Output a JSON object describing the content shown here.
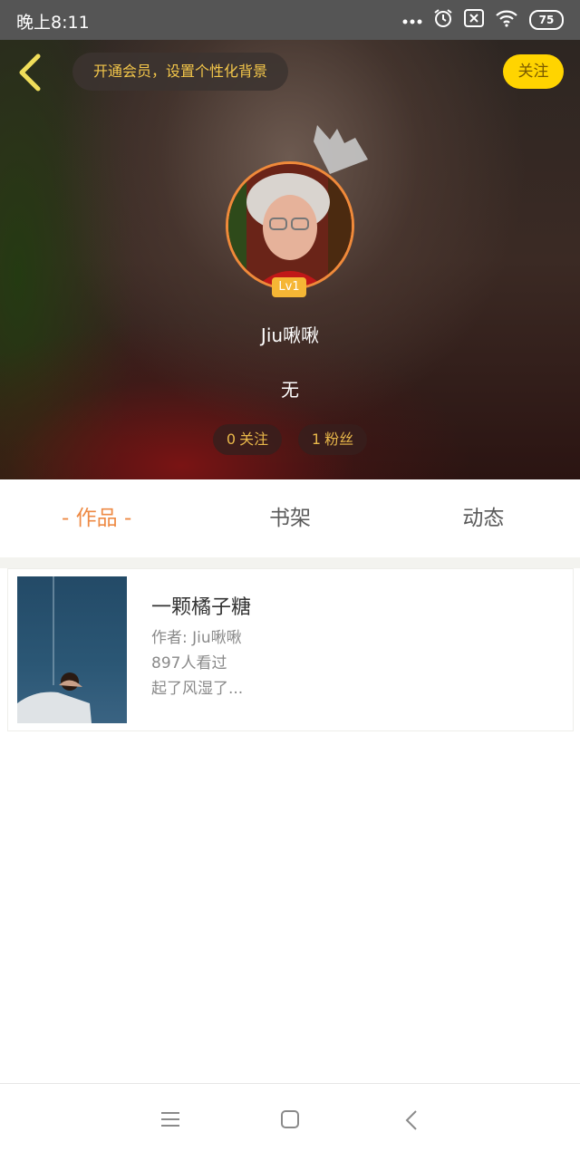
{
  "status_bar": {
    "time": "晚上8:11",
    "battery": "75",
    "icons": [
      "more-dots-icon",
      "alarm-icon",
      "sim-off-icon",
      "wifi-icon",
      "battery-icon"
    ]
  },
  "header": {
    "vip_banner": "开通会员，设置个性化背景",
    "follow_label": "关注",
    "accent_color": "#ffd400"
  },
  "profile": {
    "level": "Lv1",
    "username": "Jiu啾啾",
    "bio": "无",
    "following_count": "0",
    "following_label": "关注",
    "fans_count": "1",
    "fans_label": "粉丝"
  },
  "tabs": [
    {
      "label": "- 作品 -",
      "active": true
    },
    {
      "label": "书架",
      "active": false
    },
    {
      "label": "动态",
      "active": false
    }
  ],
  "works": [
    {
      "title": "一颗橘子糖",
      "author": "作者: Jiu啾啾",
      "views": "897人看过",
      "description": "起了风湿了..."
    }
  ],
  "navbar": {
    "icons": [
      "menu-icon",
      "home-square-icon",
      "back-chevron-icon"
    ]
  }
}
